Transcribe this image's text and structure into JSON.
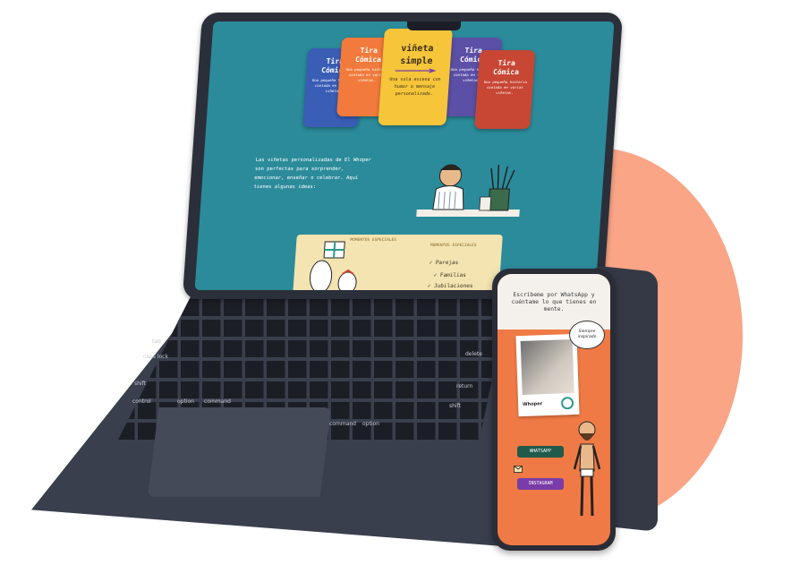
{
  "laptop": {
    "cards": [
      {
        "title_line1": "Tira",
        "title_line2": "Cómica",
        "desc": "Una pequeña historia contada en varias viñetas"
      },
      {
        "title_line1": "Tira",
        "title_line2": "Cómica",
        "desc": "Una pequeña historia contada en varias viñetas."
      },
      {
        "title_line1": "viñeta",
        "title_line2": "simple",
        "desc": "Una sola escena con humor o mensaje personalizado."
      },
      {
        "title_line1": "Tira",
        "title_line2": "Cómica",
        "desc": "Una pequeña historia contada en varias viñetas."
      },
      {
        "title_line1": "Tira",
        "title_line2": "Cómica",
        "desc": "Una pequeña historia contada en varias viñetas."
      }
    ],
    "hero_text": "Las viñetas personalizadas de El Whoper son perfectas para sorprender, emocionar, enseñar o celebrar. Aquí tienes algunas ideas:",
    "moments_tag": "MOMENTOS ESPECIALES",
    "moments_list": [
      "Parejas",
      "Familias",
      "Jubilaciones"
    ],
    "keys": {
      "caps": "caps lock",
      "tab": "tab",
      "esc": "esc",
      "shift": "shift",
      "control": "control",
      "option": "option",
      "command": "command",
      "delete": "delete",
      "return": "return"
    }
  },
  "phone": {
    "heading": "Escríbeme por WhatsApp y cuéntame lo que tienes en mente.",
    "bubble": "Siempre inspirado",
    "polaroid_brand": "Whoper",
    "cta_whatsapp": "WHATSAPP",
    "cta_instagram": "INSTAGRAM"
  },
  "colors": {
    "screen_bg": "#2b8b9a",
    "accent_circle": "#f9a586",
    "phone_bg": "#f07a45",
    "whatsapp": "#1f5a4a",
    "instagram": "#7a3ca8"
  }
}
